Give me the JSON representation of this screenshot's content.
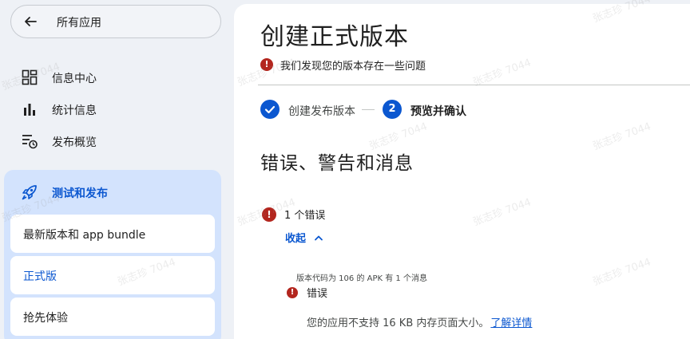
{
  "sidebar": {
    "back_label": "所有应用",
    "items": [
      {
        "label": "信息中心",
        "icon": "dashboard-icon"
      },
      {
        "label": "统计信息",
        "icon": "bar-chart-icon"
      },
      {
        "label": "发布概览",
        "icon": "publishing-overview-icon"
      }
    ],
    "group": {
      "label": "测试和发布",
      "icon": "rocket-icon",
      "sub_items": [
        {
          "label": "最新版本和 app bundle"
        },
        {
          "label": "正式版"
        },
        {
          "label": "抢先体验"
        }
      ]
    }
  },
  "main": {
    "title": "创建正式版本",
    "issue_text": "我们发现您的版本存在一些问题",
    "steps": [
      {
        "label": "创建发布版本",
        "state": "done"
      },
      {
        "label": "预览并确认",
        "number": "2",
        "state": "active"
      }
    ],
    "section_title": "错误、警告和消息",
    "error_count": "1 个错误",
    "collapse_label": "收起",
    "apk_note": "版本代码为 106 的 APK 有 1 个消息",
    "error_label": "错误",
    "error_detail": "您的应用不支持 16 KB 内存页面大小。",
    "learn_more": "了解详情"
  },
  "watermark": "张志珍 7044",
  "colors": {
    "accent": "#0b57d0",
    "error": "#b3261e",
    "selected_bg": "#d3e3fd",
    "page_bg": "#eef1f6"
  }
}
